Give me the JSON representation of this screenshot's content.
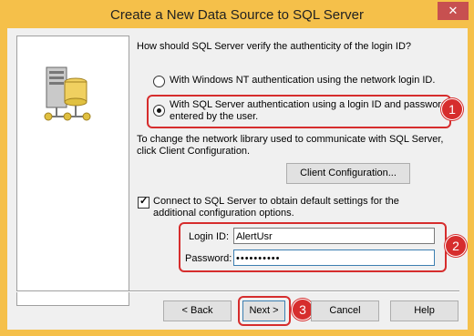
{
  "window": {
    "title": "Create a New Data Source to SQL Server",
    "close_glyph": "✕"
  },
  "question": "How should SQL Server verify the authenticity of the login ID?",
  "auth_options": [
    {
      "label": "With Windows NT authentication using the network login ID.",
      "selected": false
    },
    {
      "label_line1": "With SQL Server authentication using a login ID and password",
      "label_line2": "entered by the user.",
      "selected": true
    }
  ],
  "network_library": {
    "text_line1": "To change the network library used to communicate with SQL Server,",
    "text_line2": "click Client Configuration.",
    "button_label": "Client Configuration..."
  },
  "connect_option": {
    "checked": true,
    "label_line1": "Connect to SQL Server to obtain default settings for the",
    "label_line2": "additional configuration options."
  },
  "login": {
    "login_id_label": "Login ID:",
    "login_id_value": "AlertUsr",
    "password_label": "Password:",
    "password_value": "••••••••••"
  },
  "buttons": {
    "back": "< Back",
    "next": "Next >",
    "cancel": "Cancel",
    "help": "Help"
  },
  "callouts": [
    "1",
    "2",
    "3"
  ],
  "colors": {
    "title_bar": "#f5c04a",
    "callout": "#d62d2d",
    "close": "#c75050"
  }
}
